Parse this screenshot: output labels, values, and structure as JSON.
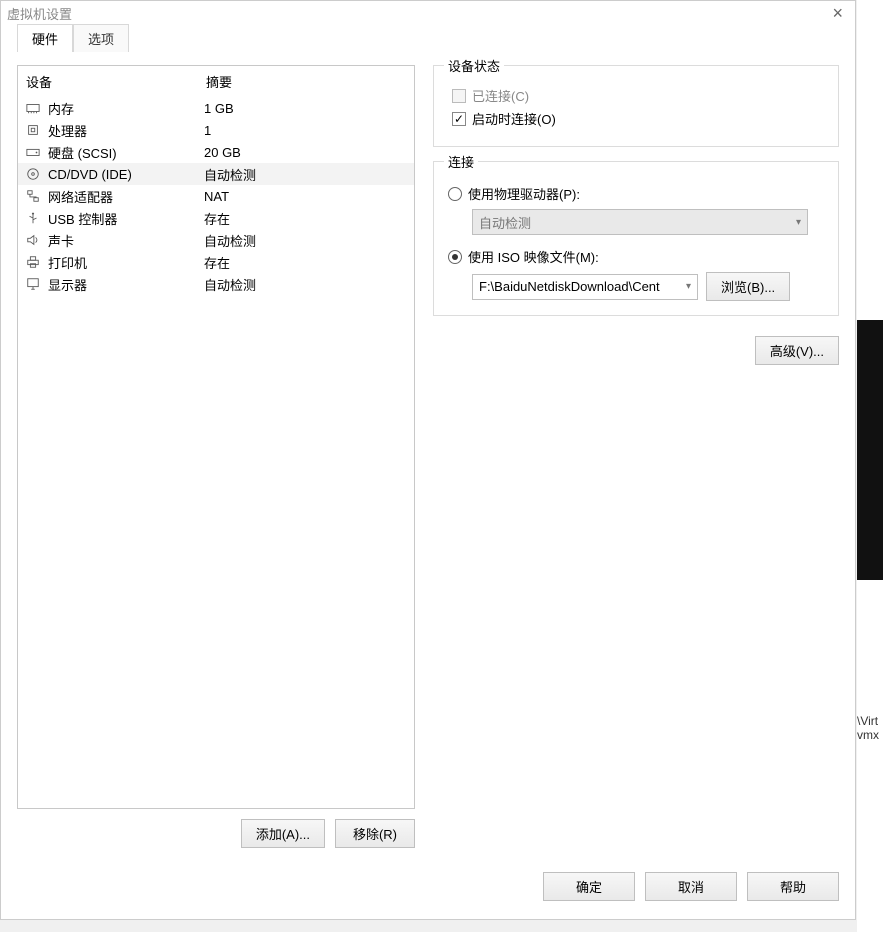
{
  "window": {
    "title": "虚拟机设置"
  },
  "tabs": {
    "hardware": "硬件",
    "options": "选项"
  },
  "columns": {
    "device": "设备",
    "summary": "摘要"
  },
  "hardware": [
    {
      "name": "内存",
      "summary": "1 GB"
    },
    {
      "name": "处理器",
      "summary": "1"
    },
    {
      "name": "硬盘 (SCSI)",
      "summary": "20 GB"
    },
    {
      "name": "CD/DVD (IDE)",
      "summary": "自动检测"
    },
    {
      "name": "网络适配器",
      "summary": "NAT"
    },
    {
      "name": "USB 控制器",
      "summary": "存在"
    },
    {
      "name": "声卡",
      "summary": "自动检测"
    },
    {
      "name": "打印机",
      "summary": "存在"
    },
    {
      "name": "显示器",
      "summary": "自动检测"
    }
  ],
  "groups": {
    "status": {
      "title": "设备状态",
      "connected": "已连接(C)",
      "connect_on_start": "启动时连接(O)"
    },
    "connect": {
      "title": "连接",
      "use_physical": "使用物理驱动器(P):",
      "physical_value": "自动检测",
      "use_iso": "使用 ISO 映像文件(M):",
      "iso_value": "F:\\BaiduNetdiskDownload\\Cent",
      "browse": "浏览(B)..."
    }
  },
  "buttons": {
    "advanced": "高级(V)...",
    "add": "添加(A)...",
    "remove": "移除(R)",
    "ok": "确定",
    "cancel": "取消",
    "help": "帮助"
  },
  "side": {
    "line1": "\\Virt",
    "line2": "vmx"
  }
}
